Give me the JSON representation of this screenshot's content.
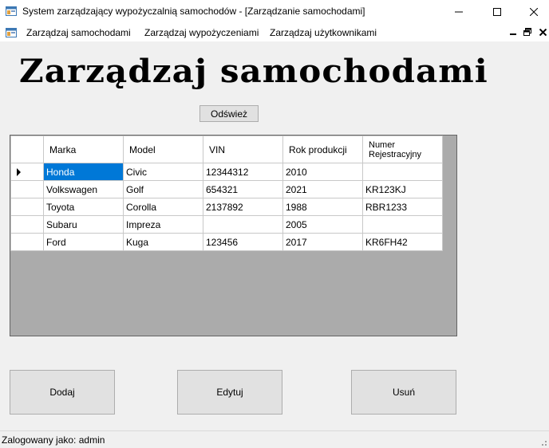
{
  "window": {
    "title": "System zarządzający wypożyczalnią samochodów - [Zarządzanie samochodami]"
  },
  "menu": {
    "items": [
      {
        "label": "Zarządzaj samochodami"
      },
      {
        "label": "Zarządzaj wypożyczeniami"
      },
      {
        "label": "Zarządzaj użytkownikami"
      }
    ]
  },
  "page": {
    "title": "Zarządzaj samochodami",
    "refresh_label": "Odśwież"
  },
  "grid": {
    "columns": [
      "Marka",
      "Model",
      "VIN",
      "Rok produkcji",
      "Numer Rejestracyjny"
    ],
    "rows": [
      [
        "Honda",
        "Civic",
        "12344312",
        "2010",
        ""
      ],
      [
        "Volkswagen",
        "Golf",
        "654321",
        "2021",
        "KR123KJ"
      ],
      [
        "Toyota",
        "Corolla",
        "2137892",
        "1988",
        "RBR1233"
      ],
      [
        "Subaru",
        "Impreza",
        "",
        "2005",
        ""
      ],
      [
        "Ford",
        "Kuga",
        "123456",
        "2017",
        "KR6FH42"
      ]
    ],
    "selected_row": 0,
    "selection_color": "#0078d7"
  },
  "actions": {
    "add_label": "Dodaj",
    "edit_label": "Edytuj",
    "delete_label": "Usuń"
  },
  "status": {
    "text": "Zalogowany jako: admin"
  },
  "icons": {
    "app": "form-icon",
    "minimize": "minimize-icon",
    "maximize": "maximize-icon",
    "close": "close-icon",
    "row_indicator": "current-row-arrow-icon"
  }
}
